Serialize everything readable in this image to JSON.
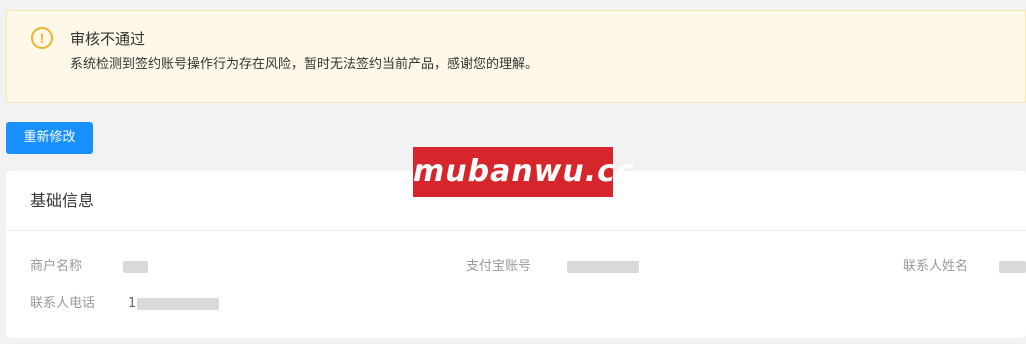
{
  "alert": {
    "icon": "exclamation-circle-icon",
    "icon_glyph": "!",
    "title": "审核不通过",
    "description": "系统检测到签约账号操作行为存在风险，暂时无法签约当前产品，感谢您的理解。"
  },
  "actions": {
    "modify_label": "重新修改"
  },
  "watermark": {
    "text": "mubanwu.cc"
  },
  "basic_info": {
    "title": "基础信息",
    "fields": [
      {
        "label": "商户名称",
        "value": ""
      },
      {
        "label": "支付宝账号",
        "value": ""
      },
      {
        "label": "联系人姓名",
        "value": ""
      },
      {
        "label": "联系人电话",
        "value": "1"
      }
    ]
  },
  "colors": {
    "accent": "#1890ff",
    "warning": "#f0b429",
    "alert_bg": "#fdf8e7",
    "watermark_bg": "#d6262b"
  }
}
